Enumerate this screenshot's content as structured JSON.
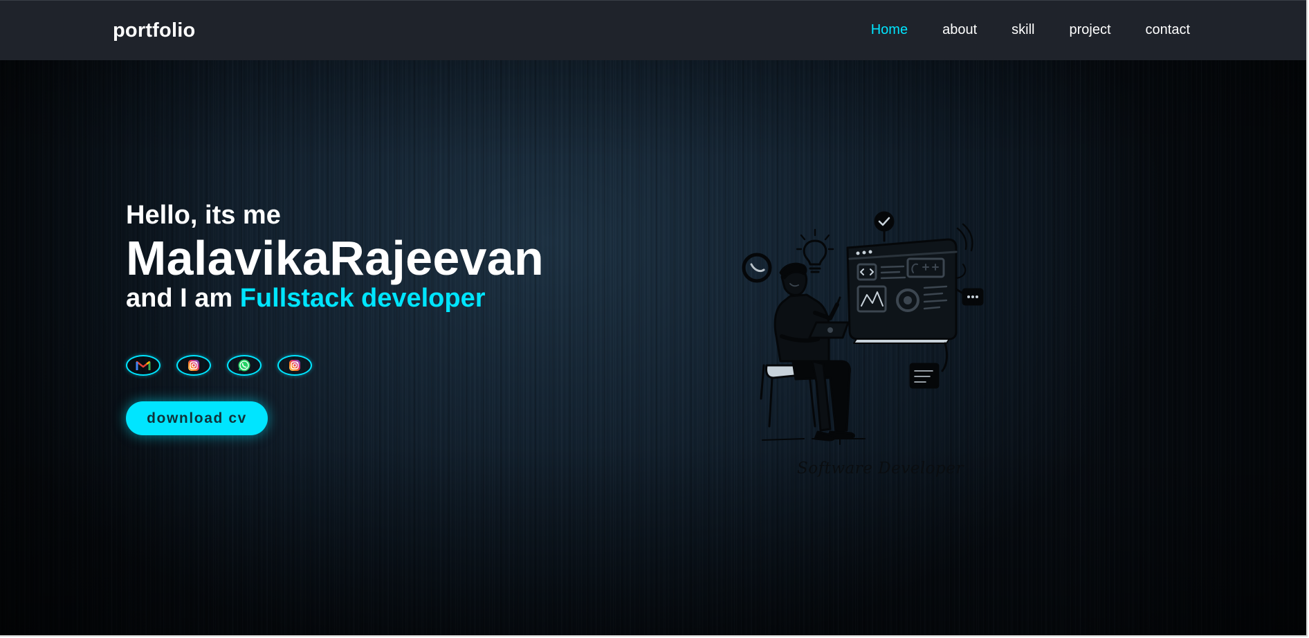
{
  "nav": {
    "brand": "portfolio",
    "links": [
      "Home",
      "about",
      "skill",
      "project",
      "contact"
    ],
    "active_link": "Home"
  },
  "hero": {
    "greeting": "Hello, its me",
    "name": "MalavikaRajeevan",
    "role_prefix": "and I am",
    "role_highlight": "Fullstack developer",
    "socials": [
      {
        "icon": "gmail-icon"
      },
      {
        "icon": "instagram-icon"
      },
      {
        "icon": "whatsapp-icon"
      },
      {
        "icon": "instagram-icon"
      }
    ],
    "cv_button": "download cv",
    "illustration_caption": "Software Developer"
  },
  "colors": {
    "accent": "#00e5ff",
    "nav_bg": "#1f232b",
    "hero_bg": "#142331",
    "text": "#ffffff"
  }
}
